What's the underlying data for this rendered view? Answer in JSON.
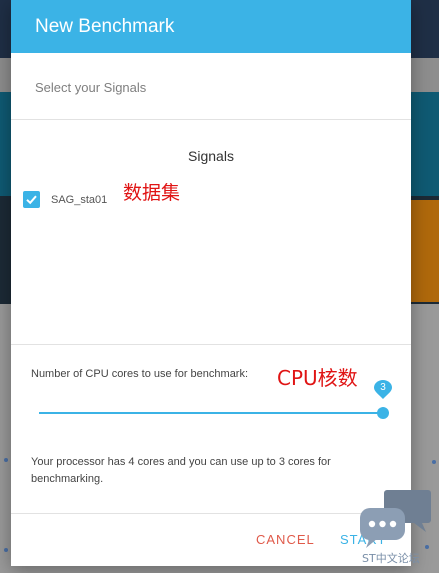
{
  "modal": {
    "title": "New Benchmark",
    "subheader": "Select your Signals",
    "signals_heading": "Signals",
    "signals": [
      {
        "label": "SAG_sta01",
        "checked": true
      }
    ],
    "cpu_label": "Number of CPU cores to use for benchmark:",
    "cpu_slider": {
      "value": 3,
      "max": 3,
      "display": "3"
    },
    "info_text": "Your processor has 4 cores and you can use up to 3 cores for benchmarking.",
    "cancel_label": "CANCEL",
    "start_label": "START"
  },
  "annotations": {
    "dataset": "数据集",
    "cpu_cores": "CPU核数"
  },
  "watermark": {
    "text": "ST中文论坛",
    "icon": "chat-bubbles-icon"
  },
  "colors": {
    "accent": "#3bb3e6",
    "cancel": "#e05a4a",
    "annotation": "#e01414"
  }
}
